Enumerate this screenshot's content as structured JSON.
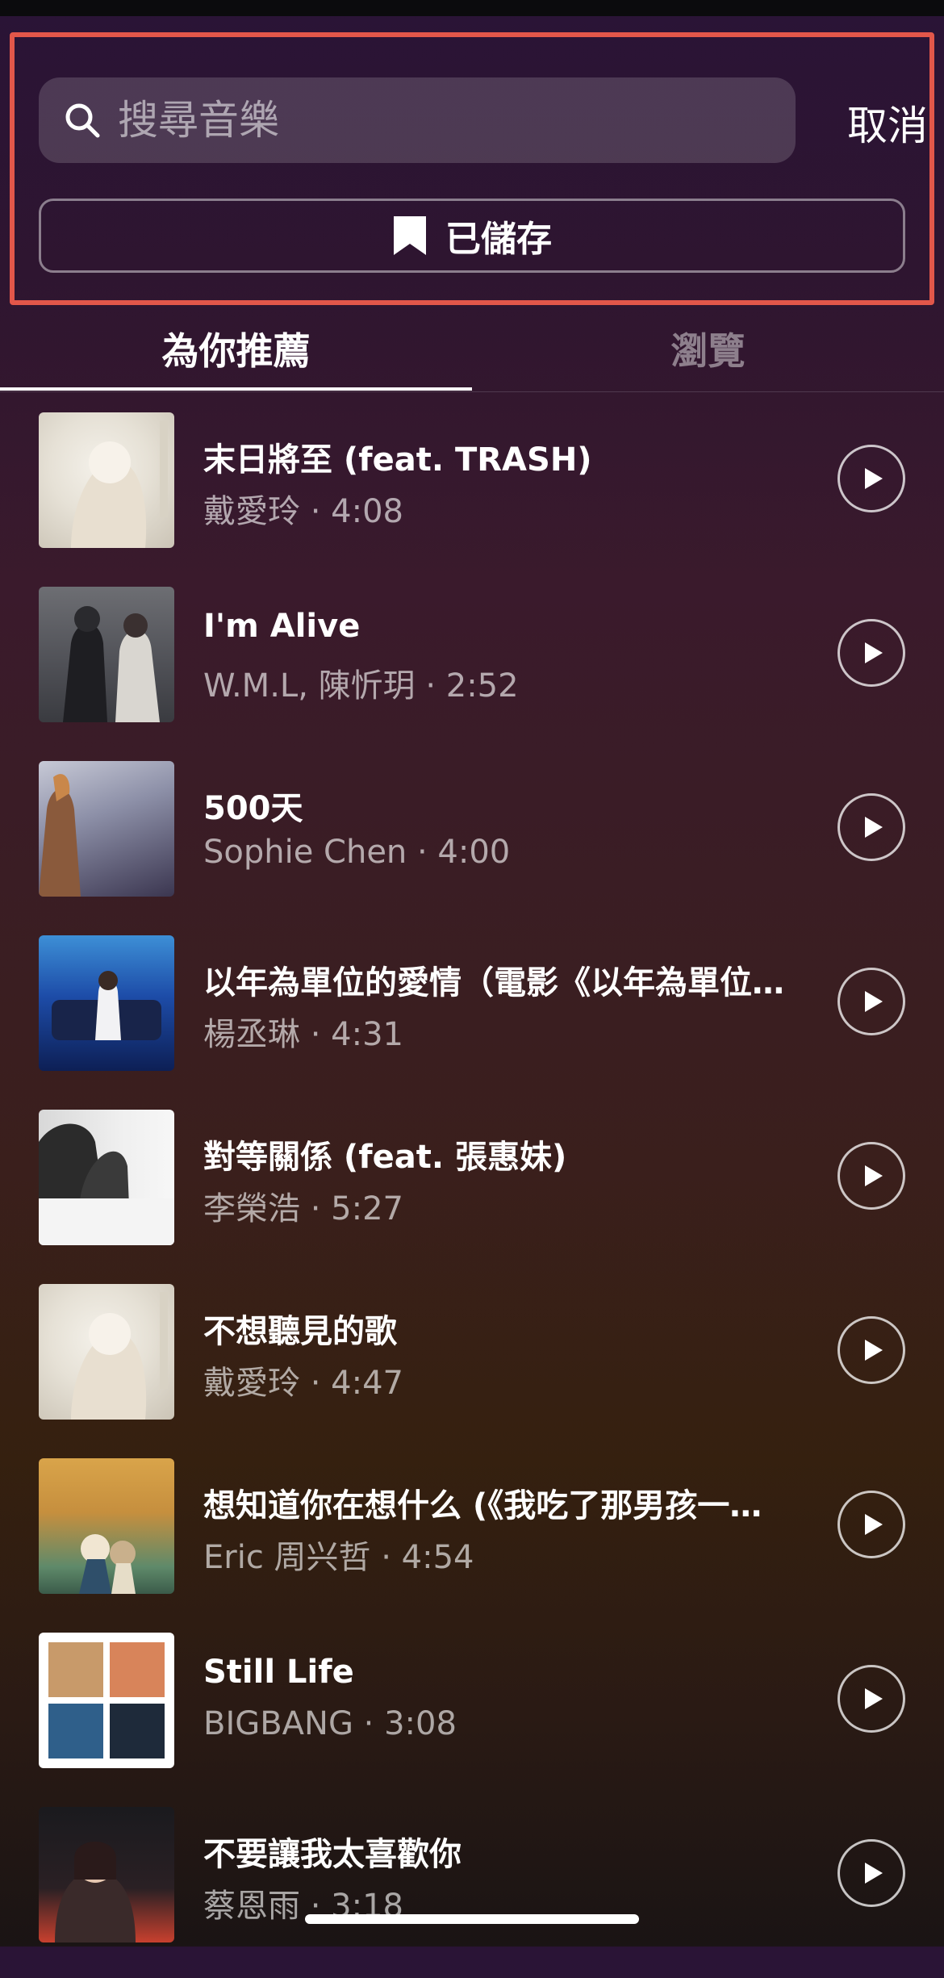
{
  "header": {
    "search_placeholder": "搜尋音樂",
    "cancel_label": "取消",
    "saved_label": "已儲存",
    "highlight_color": "#e2574a"
  },
  "tabs": [
    {
      "label": "為你推薦",
      "active": true
    },
    {
      "label": "瀏覽",
      "active": false
    }
  ],
  "songs": [
    {
      "title": "末日將至 (feat. TRASH)",
      "subtitle": "戴愛玲 · 4:08",
      "artist": "戴愛玲",
      "duration": "4:08"
    },
    {
      "title": "I'm Alive",
      "subtitle": "W.M.L, 陳忻玥 · 2:52",
      "artist": "W.M.L, 陳忻玥",
      "duration": "2:52"
    },
    {
      "title": "500天",
      "subtitle": "Sophie Chen · 4:00",
      "artist": "Sophie Chen",
      "duration": "4:00"
    },
    {
      "title": "以年為單位的愛情（電影《以年為單位的戀愛》",
      "subtitle": "楊丞琳 · 4:31",
      "artist": "楊丞琳",
      "duration": "4:31"
    },
    {
      "title": "對等關係 (feat. 張惠妹)",
      "subtitle": "李榮浩 · 5:27",
      "artist": "李榮浩",
      "duration": "5:27"
    },
    {
      "title": "不想聽見的歌",
      "subtitle": "戴愛玲 · 4:47",
      "artist": "戴愛玲",
      "duration": "4:47"
    },
    {
      "title": "想知道你在想什么 (《我吃了那男孩一整年的早餐》",
      "subtitle": "Eric 周兴哲 · 4:54",
      "artist": "Eric 周兴哲",
      "duration": "4:54"
    },
    {
      "title": "Still Life",
      "subtitle": "BIGBANG · 3:08",
      "artist": "BIGBANG",
      "duration": "3:08"
    },
    {
      "title": "不要讓我太喜歡你",
      "subtitle": "蔡恩雨 · 3:18",
      "artist": "蔡恩雨",
      "duration": "3:18"
    }
  ],
  "icons": {
    "search": "search-icon",
    "bookmark": "bookmark-icon",
    "play": "play-icon"
  }
}
